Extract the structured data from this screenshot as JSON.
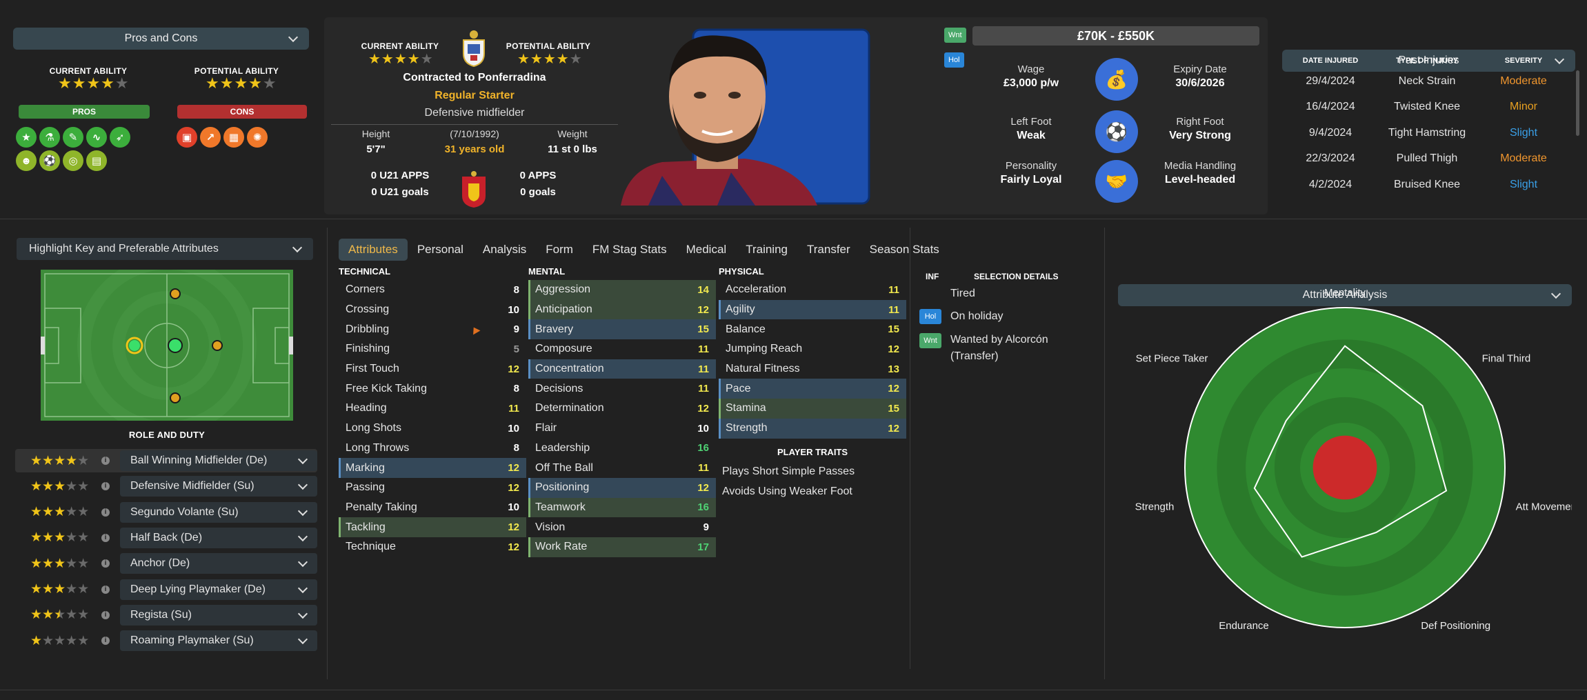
{
  "pros_cons": {
    "title": "Pros and Cons",
    "current_ability_label": "CURRENT ABILITY",
    "potential_ability_label": "POTENTIAL ABILITY",
    "current_stars": 4,
    "potential_stars": 4,
    "pros_label": "PROS",
    "cons_label": "CONS"
  },
  "profile": {
    "current_ability_label": "CURRENT ABILITY",
    "potential_ability_label": "POTENTIAL ABILITY",
    "current_stars": 4,
    "potential_stars": 4,
    "contract": "Contracted to Ponferradina",
    "status": "Regular Starter",
    "position": "Defensive midfielder",
    "height_label": "Height",
    "height": "5'7\"",
    "dob": "(7/10/1992)",
    "age": "31 years old",
    "weight_label": "Weight",
    "weight": "11 st 0 lbs",
    "u21_apps": "0 U21 APPS",
    "u21_goals": "0 U21 goals",
    "apps": "0 APPS",
    "goals": "0 goals"
  },
  "contract": {
    "value_range": "£70K - £550K",
    "wnt_badge": "Wnt",
    "hol_badge": "Hol",
    "wage_label": "Wage",
    "wage": "£3,000 p/w",
    "expiry_label": "Expiry Date",
    "expiry": "30/6/2026",
    "left_foot_label": "Left Foot",
    "left_foot": "Weak",
    "right_foot_label": "Right Foot",
    "right_foot": "Very Strong",
    "personality_label": "Personality",
    "personality": "Fairly Loyal",
    "media_label": "Media Handling",
    "media": "Level-headed"
  },
  "injuries": {
    "title": "Past Injuries",
    "col_date": "DATE INJURED",
    "col_type": "TYPE OF INJURY",
    "col_sev": "SEVERITY",
    "rows": [
      {
        "date": "29/4/2024",
        "type": "Neck Strain",
        "sev": "Moderate",
        "color": "#f0962e"
      },
      {
        "date": "16/4/2024",
        "type": "Twisted Knee",
        "sev": "Minor",
        "color": "#e8a020"
      },
      {
        "date": "9/4/2024",
        "type": "Tight Hamstring",
        "sev": "Slight",
        "color": "#3aa0e8"
      },
      {
        "date": "22/3/2024",
        "type": "Pulled Thigh",
        "sev": "Moderate",
        "color": "#f0962e"
      },
      {
        "date": "4/2/2024",
        "type": "Bruised Knee",
        "sev": "Slight",
        "color": "#3aa0e8"
      }
    ]
  },
  "highlight": {
    "title": "Highlight Key and Preferable Attributes",
    "role_duty": "ROLE AND DUTY"
  },
  "roles": [
    {
      "name": "Ball Winning Midfielder (De)",
      "stars": 4
    },
    {
      "name": "Defensive Midfielder (Su)",
      "stars": 3
    },
    {
      "name": "Segundo Volante (Su)",
      "stars": 3
    },
    {
      "name": "Half Back (De)",
      "stars": 3
    },
    {
      "name": "Anchor (De)",
      "stars": 3
    },
    {
      "name": "Deep Lying Playmaker (De)",
      "stars": 3
    },
    {
      "name": "Regista (Su)",
      "stars": 2.5
    },
    {
      "name": "Roaming Playmaker (Su)",
      "stars": 1
    }
  ],
  "tabs": [
    "Attributes",
    "Personal",
    "Analysis",
    "Form",
    "FM Stag Stats",
    "Medical",
    "Training",
    "Transfer",
    "Season Stats"
  ],
  "technical": {
    "title": "TECHNICAL",
    "items": [
      {
        "n": "Corners",
        "v": "8",
        "c": "w"
      },
      {
        "n": "Crossing",
        "v": "10",
        "c": "w"
      },
      {
        "n": "Dribbling",
        "v": "9",
        "c": "w"
      },
      {
        "n": "Finishing",
        "v": "5",
        "c": "gr"
      },
      {
        "n": "First Touch",
        "v": "12",
        "c": "y"
      },
      {
        "n": "Free Kick Taking",
        "v": "8",
        "c": "w"
      },
      {
        "n": "Heading",
        "v": "11",
        "c": "y"
      },
      {
        "n": "Long Shots",
        "v": "10",
        "c": "w"
      },
      {
        "n": "Long Throws",
        "v": "8",
        "c": "w"
      },
      {
        "n": "Marking",
        "v": "12",
        "c": "y",
        "h": "hl"
      },
      {
        "n": "Passing",
        "v": "12",
        "c": "y"
      },
      {
        "n": "Penalty Taking",
        "v": "10",
        "c": "w"
      },
      {
        "n": "Tackling",
        "v": "12",
        "c": "y",
        "h": "hg"
      },
      {
        "n": "Technique",
        "v": "12",
        "c": "y"
      }
    ]
  },
  "mental": {
    "title": "MENTAL",
    "items": [
      {
        "n": "Aggression",
        "v": "14",
        "c": "y",
        "h": "hg"
      },
      {
        "n": "Anticipation",
        "v": "12",
        "c": "y",
        "h": "hg"
      },
      {
        "n": "Bravery",
        "v": "15",
        "c": "y",
        "h": "hl"
      },
      {
        "n": "Composure",
        "v": "11",
        "c": "y"
      },
      {
        "n": "Concentration",
        "v": "11",
        "c": "y",
        "h": "hl"
      },
      {
        "n": "Decisions",
        "v": "11",
        "c": "y"
      },
      {
        "n": "Determination",
        "v": "12",
        "c": "y"
      },
      {
        "n": "Flair",
        "v": "10",
        "c": "w"
      },
      {
        "n": "Leadership",
        "v": "16",
        "c": "g"
      },
      {
        "n": "Off The Ball",
        "v": "11",
        "c": "y"
      },
      {
        "n": "Positioning",
        "v": "12",
        "c": "y",
        "h": "hl"
      },
      {
        "n": "Teamwork",
        "v": "16",
        "c": "g",
        "h": "hg"
      },
      {
        "n": "Vision",
        "v": "9",
        "c": "w"
      },
      {
        "n": "Work Rate",
        "v": "17",
        "c": "g",
        "h": "hg"
      }
    ]
  },
  "physical": {
    "title": "PHYSICAL",
    "items": [
      {
        "n": "Acceleration",
        "v": "11",
        "c": "y"
      },
      {
        "n": "Agility",
        "v": "11",
        "c": "y",
        "h": "hl"
      },
      {
        "n": "Balance",
        "v": "15",
        "c": "y"
      },
      {
        "n": "Jumping Reach",
        "v": "12",
        "c": "y"
      },
      {
        "n": "Natural Fitness",
        "v": "13",
        "c": "y"
      },
      {
        "n": "Pace",
        "v": "12",
        "c": "y",
        "h": "hl"
      },
      {
        "n": "Stamina",
        "v": "15",
        "c": "y",
        "h": "hg"
      },
      {
        "n": "Strength",
        "v": "12",
        "c": "y",
        "h": "hl"
      }
    ]
  },
  "traits": {
    "title": "PLAYER TRAITS",
    "items": [
      "Plays Short Simple Passes",
      "Avoids Using Weaker Foot"
    ]
  },
  "selection": {
    "inf_label": "INF",
    "title": "SELECTION DETAILS",
    "tired": "Tired",
    "hol": "Hol",
    "holiday": "On holiday",
    "wnt": "Wnt",
    "wanted": "Wanted by Alcorcón",
    "wanted2": "(Transfer)"
  },
  "analysis": {
    "title": "Attribute Analysis",
    "labels": [
      "Mentality",
      "Final Third",
      "Att Movement",
      "Def Positioning",
      "Endurance",
      "Strength",
      "Set Piece Taker"
    ],
    "values": [
      0.76,
      0.62,
      0.65,
      0.45,
      0.62,
      0.58,
      0.47
    ]
  }
}
